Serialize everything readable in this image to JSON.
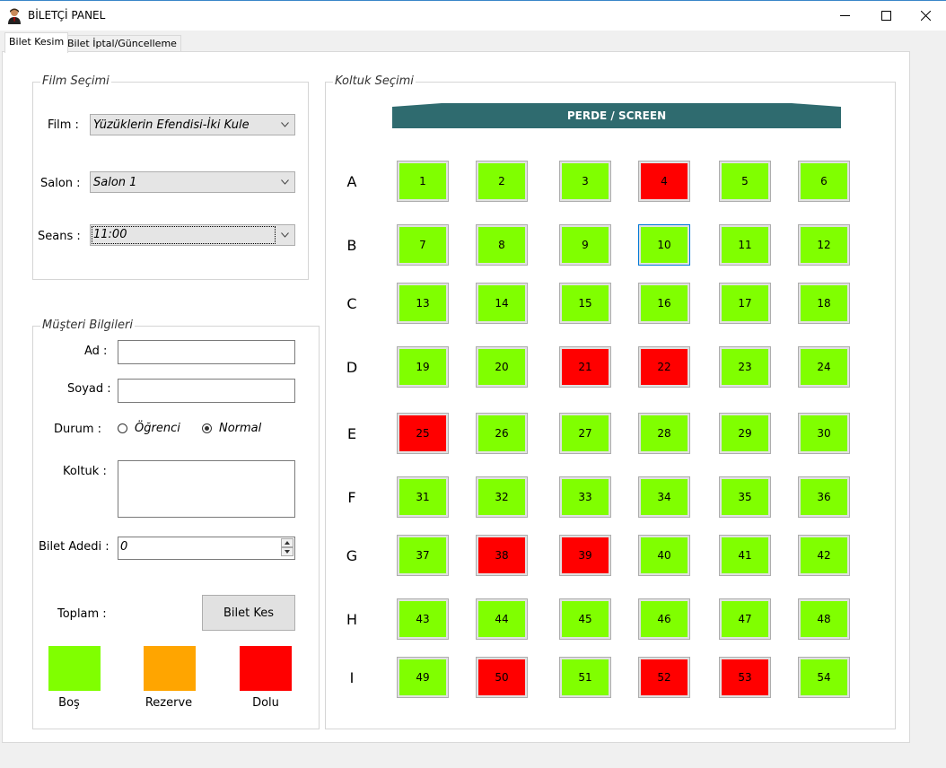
{
  "window": {
    "title": "BİLETÇİ PANEL",
    "controls": [
      "minimize-icon",
      "maximize-icon",
      "close-icon"
    ]
  },
  "tabs": [
    {
      "label": "Bilet Kesim",
      "active": true
    },
    {
      "label": "Bilet İptal/Güncelleme",
      "active": false
    }
  ],
  "film_group": {
    "legend": "Film Seçimi",
    "film_label": "Film :",
    "film_value": "Yüzüklerin Efendisi-İki Kule",
    "salon_label": "Salon :",
    "salon_value": "Salon 1",
    "seans_label": "Seans :",
    "seans_value": "11:00"
  },
  "customer_group": {
    "legend": "Müşteri Bilgileri",
    "ad_label": "Ad :",
    "ad_value": "",
    "soyad_label": "Soyad :",
    "soyad_value": "",
    "durum_label": "Durum :",
    "option_ogrenci": "Öğrenci",
    "option_normal": "Normal",
    "selected_option": "Normal",
    "koltuk_label": "Koltuk :",
    "koltuk_value": "",
    "bilet_adedi_label": "Bilet Adedi :",
    "bilet_adedi_value": "0",
    "toplam_label": "Toplam :",
    "bilet_kes_button": "Bilet Kes",
    "legend_items": [
      {
        "label": "Boş",
        "color": "#80ff00"
      },
      {
        "label": "Rezerve",
        "color": "#ffa500"
      },
      {
        "label": "Dolu",
        "color": "#ff0000"
      }
    ]
  },
  "seat_group": {
    "legend": "Koltuk Seçimi",
    "screen_label": "PERDE / SCREEN",
    "rows": [
      "A",
      "B",
      "C",
      "D",
      "E",
      "F",
      "G",
      "H",
      "I"
    ],
    "colors": {
      "empty": "#80ff00",
      "full": "#ff0000"
    },
    "focused_seat": "10",
    "seats": [
      {
        "label": "1",
        "status": "empty"
      },
      {
        "label": "2",
        "status": "empty"
      },
      {
        "label": "3",
        "status": "empty"
      },
      {
        "label": "4",
        "status": "full"
      },
      {
        "label": "5",
        "status": "empty"
      },
      {
        "label": "6",
        "status": "empty"
      },
      {
        "label": "7",
        "status": "empty"
      },
      {
        "label": "8",
        "status": "empty"
      },
      {
        "label": "9",
        "status": "empty"
      },
      {
        "label": "10",
        "status": "empty"
      },
      {
        "label": "11",
        "status": "empty"
      },
      {
        "label": "12",
        "status": "empty"
      },
      {
        "label": "13",
        "status": "empty"
      },
      {
        "label": "14",
        "status": "empty"
      },
      {
        "label": "15",
        "status": "empty"
      },
      {
        "label": "16",
        "status": "empty"
      },
      {
        "label": "17",
        "status": "empty"
      },
      {
        "label": "18",
        "status": "empty"
      },
      {
        "label": "19",
        "status": "empty"
      },
      {
        "label": "20",
        "status": "empty"
      },
      {
        "label": "21",
        "status": "full"
      },
      {
        "label": "22",
        "status": "full"
      },
      {
        "label": "23",
        "status": "empty"
      },
      {
        "label": "24",
        "status": "empty"
      },
      {
        "label": "25",
        "status": "full"
      },
      {
        "label": "26",
        "status": "empty"
      },
      {
        "label": "27",
        "status": "empty"
      },
      {
        "label": "28",
        "status": "empty"
      },
      {
        "label": "29",
        "status": "empty"
      },
      {
        "label": "30",
        "status": "empty"
      },
      {
        "label": "31",
        "status": "empty"
      },
      {
        "label": "32",
        "status": "empty"
      },
      {
        "label": "33",
        "status": "empty"
      },
      {
        "label": "34",
        "status": "empty"
      },
      {
        "label": "35",
        "status": "empty"
      },
      {
        "label": "36",
        "status": "empty"
      },
      {
        "label": "37",
        "status": "empty"
      },
      {
        "label": "38",
        "status": "full"
      },
      {
        "label": "39",
        "status": "full"
      },
      {
        "label": "40",
        "status": "empty"
      },
      {
        "label": "41",
        "status": "empty"
      },
      {
        "label": "42",
        "status": "empty"
      },
      {
        "label": "43",
        "status": "empty"
      },
      {
        "label": "44",
        "status": "empty"
      },
      {
        "label": "45",
        "status": "empty"
      },
      {
        "label": "46",
        "status": "empty"
      },
      {
        "label": "47",
        "status": "empty"
      },
      {
        "label": "48",
        "status": "empty"
      },
      {
        "label": "49",
        "status": "empty"
      },
      {
        "label": "50",
        "status": "full"
      },
      {
        "label": "51",
        "status": "empty"
      },
      {
        "label": "52",
        "status": "full"
      },
      {
        "label": "53",
        "status": "full"
      },
      {
        "label": "54",
        "status": "empty"
      }
    ]
  }
}
